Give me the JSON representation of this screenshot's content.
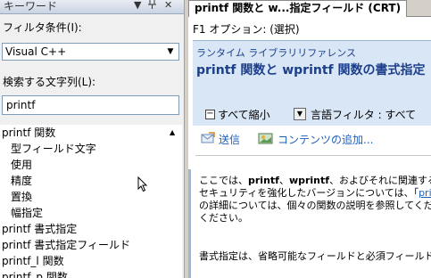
{
  "left_pane": {
    "header_title": "キーワード",
    "header_icons": [
      "dropdown-icon",
      "pin-icon",
      "close-icon"
    ],
    "filter_label": "フィルタ条件(I):",
    "filter_value": "Visual C++",
    "search_label": "検索する文字列(L):",
    "search_value": "printf",
    "index_items": [
      {
        "label": "printf 関数",
        "indent": false
      },
      {
        "label": "型フィールド文字",
        "indent": true
      },
      {
        "label": "使用",
        "indent": true
      },
      {
        "label": "精度",
        "indent": true
      },
      {
        "label": "置換",
        "indent": true
      },
      {
        "label": "幅指定",
        "indent": true
      },
      {
        "label": "printf 書式指定",
        "indent": false
      },
      {
        "label": "printf 書式指定フィールド",
        "indent": false
      },
      {
        "label": "printf_l 関数",
        "indent": false
      },
      {
        "label": "printf_p 関数",
        "indent": false
      }
    ]
  },
  "right_pane": {
    "tab_label": "printf 関数と w...指定フィールド (CRT)",
    "f1_option": "F1 オプション: (選択)",
    "runtime_ref": "ランタイム ライブラリリファレンス",
    "doc_title": "printf 関数と wprintf 関数の書式指定",
    "collapse_all": "すべて縮小",
    "lang_filter": "言語フィルタ : すべて",
    "send_link": "送信",
    "add_content_link": "コンテンツの追加...",
    "body_line1_a": "ここでは、",
    "body_line1_b": "printf",
    "body_line1_c": "、",
    "body_line1_d": "wprintf",
    "body_line1_e": "、およびそれに関連する",
    "body_line2_a": "セキュリティを強化したバージョンについては、「",
    "body_line2_link": "prin",
    "body_line3": "の詳細については、個々の関数の説明を参照してくだ",
    "body_line4": "ください。",
    "para2": "書式指定は、省略可能なフィールドと必須フィールド"
  },
  "colors": {
    "header_blue": "#d9e6f5",
    "title_blue": "#1c3f8c",
    "link_blue": "#1c5fb8"
  }
}
